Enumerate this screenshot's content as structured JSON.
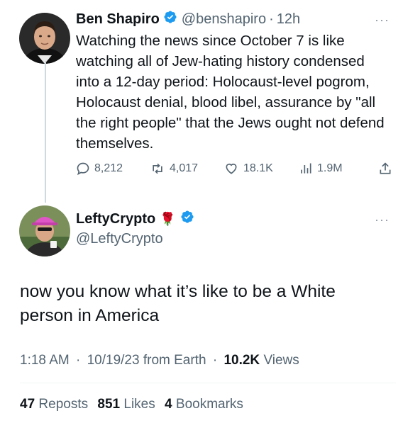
{
  "tweet": {
    "author_name": "Ben Shapiro",
    "handle": "@benshapiro",
    "separator": "·",
    "time": "12h",
    "more": "···",
    "text": "Watching the news since October 7 is like watching all of Jew-hating history condensed into a 12-day period: Holocaust-level pogrom, Holocaust denial, blood libel, assurance by \"all the right people\" that the Jews ought not defend themselves.",
    "replies": "8,212",
    "reposts": "4,017",
    "likes": "18.1K",
    "views": "1.9M"
  },
  "reply": {
    "author_name": "LeftyCrypto",
    "handle": "@LeftyCrypto",
    "more": "···",
    "emoji": "🌹",
    "text": "now you know what it’s like to be a White person in America",
    "time": "1:18 AM",
    "separator": "·",
    "date": "10/19/23",
    "source": "from Earth",
    "views_count": "10.2K",
    "views_label": "Views",
    "reposts_count": "47",
    "reposts_label": "Reposts",
    "likes_count": "851",
    "likes_label": "Likes",
    "bookmarks_count": "4",
    "bookmarks_label": "Bookmarks"
  },
  "icons": {
    "verified": "verified-badge-icon",
    "reply": "reply-icon",
    "repost": "repost-icon",
    "like": "heart-icon",
    "views": "views-icon",
    "share": "share-icon"
  },
  "colors": {
    "verified": "#1d9bf0",
    "text": "#0f1419",
    "secondary": "#536471",
    "rose": "#c8102e"
  }
}
